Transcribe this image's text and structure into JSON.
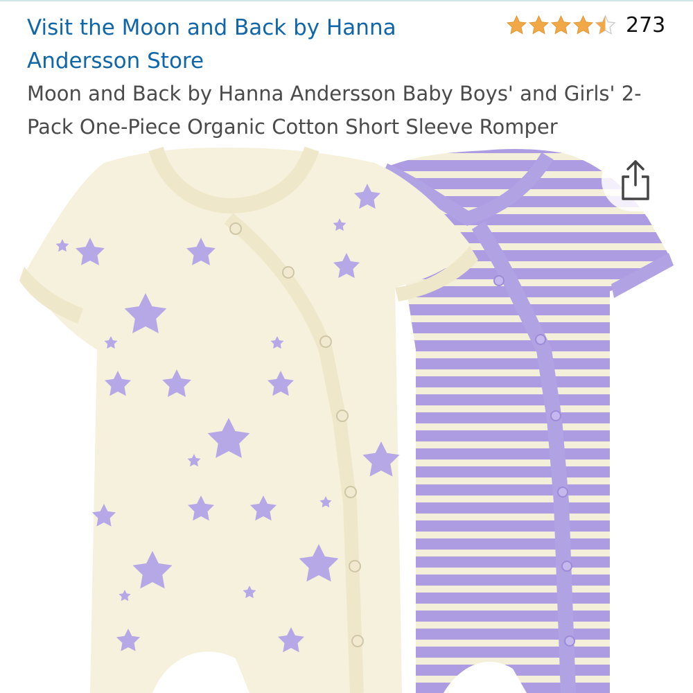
{
  "header": {
    "store_link": "Visit the Moon and Back by Hanna Andersson Store",
    "rating": {
      "value": 4.5,
      "out_of": 5,
      "review_count": "273",
      "star_color": "#f3a847"
    },
    "title": "Moon and Back by Hanna Andersson Baby Boys' and Girls' 2-Pack One-Piece Organic Cotton Short Sleeve Romper",
    "link_color": "#0f66a8"
  },
  "product_image": {
    "colors": {
      "cream": "#f6f1dd",
      "lavender": "#b6a8e6",
      "stripe": "#a896e0"
    }
  },
  "actions": {
    "share_icon": "share-icon"
  }
}
